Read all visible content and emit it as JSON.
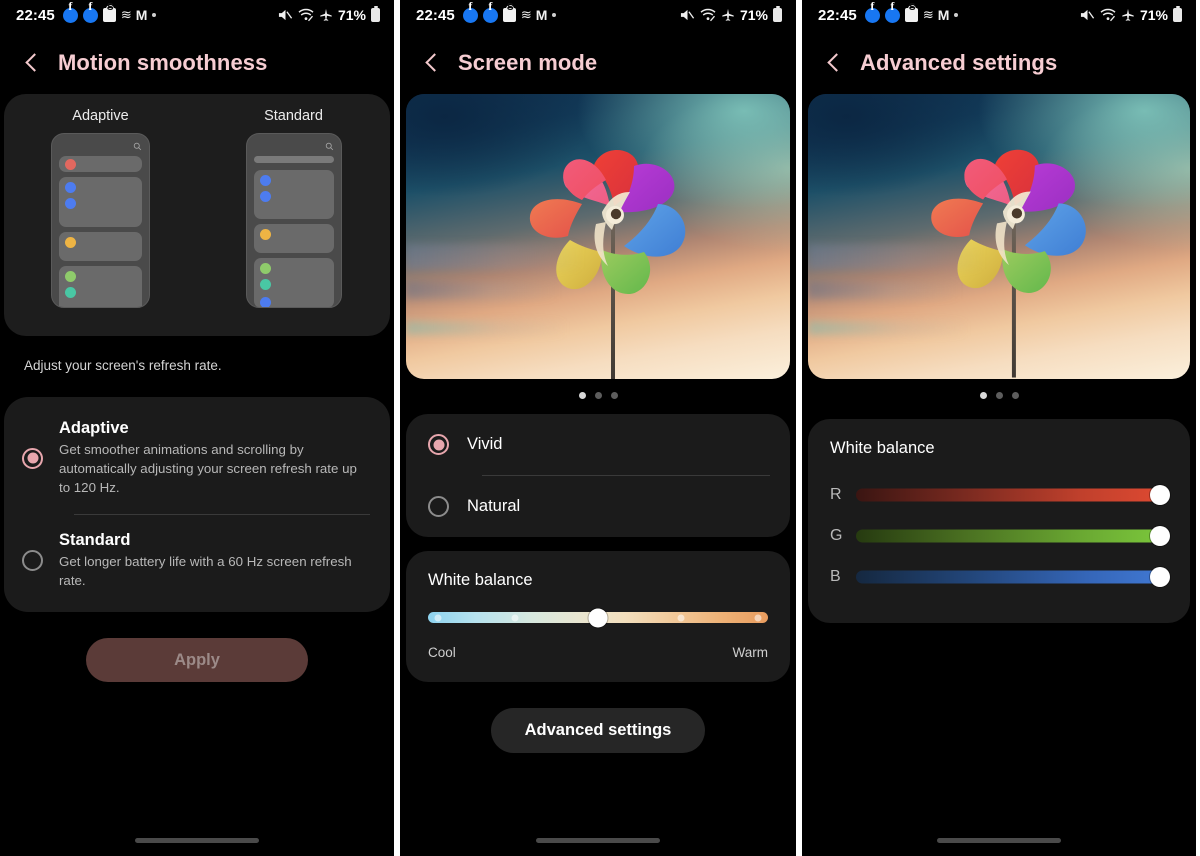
{
  "statusbar": {
    "time": "22:45",
    "battery_percent": "71%",
    "left_icons": [
      "facebook-icon",
      "facebook-icon",
      "shopping-bag-icon",
      "squiggle-icon",
      "gmail-icon",
      "more-dot-icon"
    ],
    "right_icons": [
      "mute-icon",
      "wifi-off-icon",
      "airplane-mode-icon",
      "battery-icon"
    ]
  },
  "panel1": {
    "header_title": "Motion smoothness",
    "preview": {
      "left_label": "Adaptive",
      "right_label": "Standard",
      "dot_colors": [
        "#e2685f",
        "#4d7cf0",
        "#4d7cf0",
        "#eeb444",
        "#8fcb6b",
        "#49c7a4"
      ]
    },
    "note": "Adjust your screen's refresh rate.",
    "options": [
      {
        "title": "Adaptive",
        "desc": "Get smoother animations and scrolling by automatically adjusting your screen refresh rate up to 120 Hz.",
        "selected": true
      },
      {
        "title": "Standard",
        "desc": "Get longer battery life with a 60 Hz screen refresh rate.",
        "selected": false
      }
    ],
    "apply_label": "Apply",
    "apply_enabled": false
  },
  "panel2": {
    "header_title": "Screen mode",
    "carousel": {
      "page_count": 3,
      "active_page": 1,
      "image": "pinwheel-sunset-wallpaper"
    },
    "modes": [
      {
        "label": "Vivid",
        "selected": true
      },
      {
        "label": "Natural",
        "selected": false
      }
    ],
    "white_balance": {
      "title": "White balance",
      "cool_label": "Cool",
      "warm_label": "Warm",
      "value_percent": 50,
      "tick_positions": [
        2,
        25,
        50,
        75,
        98
      ]
    },
    "advanced_button": "Advanced settings"
  },
  "panel3": {
    "header_title": "Advanced settings",
    "carousel": {
      "page_count": 3,
      "active_page": 1,
      "image": "pinwheel-sunset-wallpaper"
    },
    "white_balance": {
      "title": "White balance",
      "channels": [
        {
          "letter": "R",
          "value_percent": 100,
          "color": "#e04a32"
        },
        {
          "letter": "G",
          "value_percent": 100,
          "color": "#7cc93c"
        },
        {
          "letter": "B",
          "value_percent": 100,
          "color": "#4179d4"
        }
      ]
    }
  },
  "theme": {
    "accent": "#f6cdd2",
    "radio_accent": "#e7a6ad",
    "card_bg": "#1b1b1b",
    "page_bg": "#000000"
  }
}
